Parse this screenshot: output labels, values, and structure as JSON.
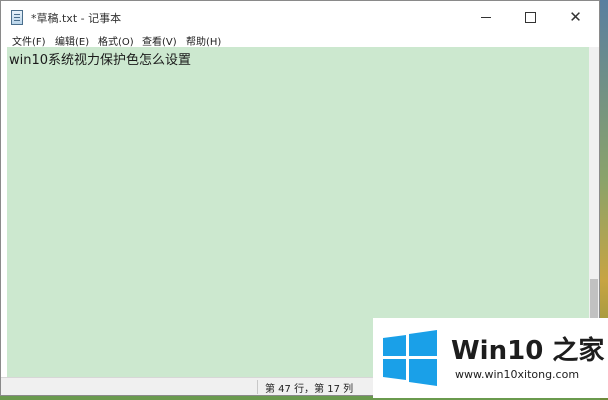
{
  "window": {
    "title": "*草稿.txt - 记事本"
  },
  "menu": {
    "items": [
      "文件(F)",
      "编辑(E)",
      "格式(O)",
      "查看(V)",
      "帮助(H)"
    ]
  },
  "editor": {
    "content": "win10系统视力保护色怎么设置",
    "background_color": "#cce8cf"
  },
  "statusbar": {
    "position": "第 47 行，第 17 列"
  },
  "watermark": {
    "brand": "Win10 之家",
    "url": "www.win10xitong.com",
    "logo_color": "#1aa0e8"
  },
  "icons": {
    "app": "notepad-icon",
    "minimize": "minimize-icon",
    "maximize": "maximize-icon",
    "close": "close-icon",
    "logo": "windows-logo-icon"
  }
}
